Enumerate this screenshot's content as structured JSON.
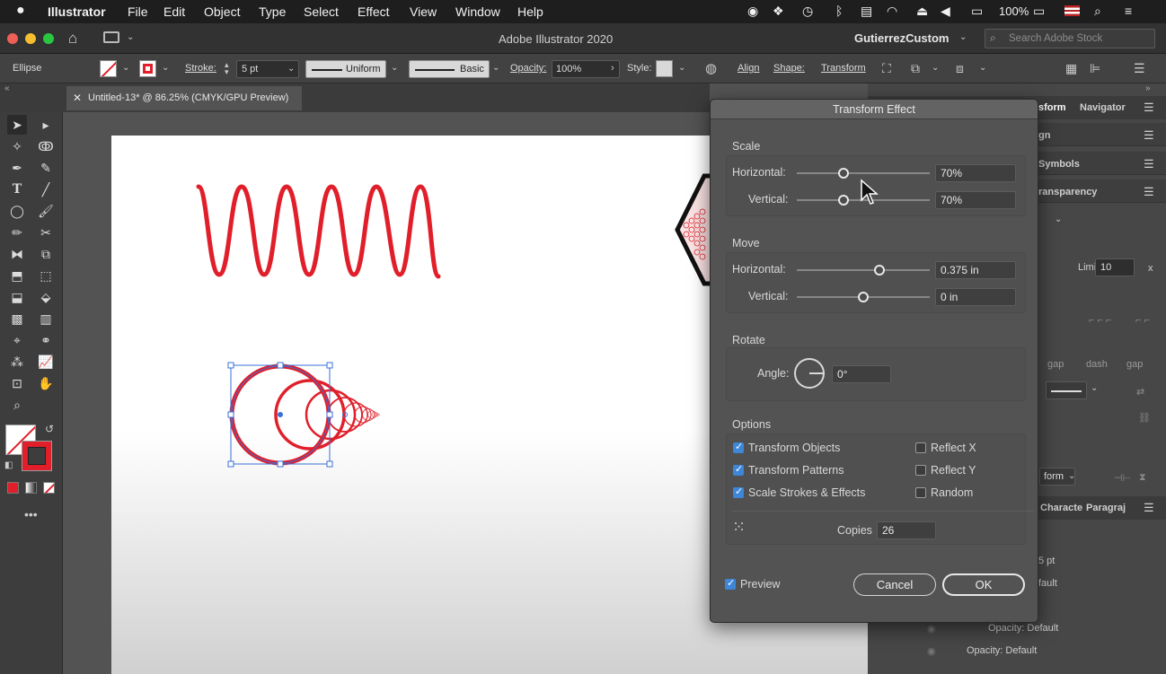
{
  "menubar": {
    "app_name": "Illustrator",
    "items": [
      "File",
      "Edit",
      "Object",
      "Type",
      "Select",
      "Effect",
      "View",
      "Window",
      "Help"
    ],
    "battery": "100%"
  },
  "appbar": {
    "title": "Adobe Illustrator 2020",
    "workspace": "GutierrezCustom",
    "search_placeholder": "Search Adobe Stock"
  },
  "control": {
    "object_type": "Ellipse",
    "stroke_label": "Stroke:",
    "stroke_weight": "5 pt",
    "profile_uniform": "Uniform",
    "brush_basic": "Basic",
    "opacity_label": "Opacity:",
    "opacity_value": "100%",
    "style_label": "Style:",
    "align_label": "Align",
    "shape_label": "Shape:",
    "transform_label": "Transform"
  },
  "document": {
    "tab_title": "Untitled-13* @ 86.25% (CMYK/GPU Preview)"
  },
  "panels": {
    "tab_transform": "sform",
    "tab_navigator": "Navigator",
    "row_align": "gn",
    "row_symbols": "Symbols",
    "row_transparency": "ransparency",
    "limit_label": "Limit:",
    "limit_value": "10",
    "dash_labels": [
      "gap",
      "dash",
      "gap"
    ],
    "transform_btn": "form",
    "tab_character": "Characte",
    "tab_paragraph": "Paragraj",
    "app_stroke": "5 pt",
    "app_fill": "fault",
    "opacity_row1": "Opacity: Default",
    "opacity_row2": "Opacity: Default"
  },
  "dialog": {
    "title": "Transform Effect",
    "scale": {
      "heading": "Scale",
      "h_label": "Horizontal:",
      "h_value": "70%",
      "v_label": "Vertical:",
      "v_value": "70%",
      "h_fraction": 0.35,
      "v_fraction": 0.35
    },
    "move": {
      "heading": "Move",
      "h_label": "Horizontal:",
      "h_value": "0.375 in",
      "v_label": "Vertical:",
      "v_value": "0 in",
      "h_fraction": 0.62,
      "v_fraction": 0.5
    },
    "rotate": {
      "heading": "Rotate",
      "angle_label": "Angle:",
      "angle_value": "0°"
    },
    "options": {
      "heading": "Options",
      "transform_objects": "Transform Objects",
      "transform_patterns": "Transform Patterns",
      "scale_strokes": "Scale Strokes & Effects",
      "reflect_x": "Reflect X",
      "reflect_y": "Reflect Y",
      "random": "Random",
      "copies_label": "Copies",
      "copies_value": "26",
      "checked": {
        "transform_objects": true,
        "transform_patterns": true,
        "scale_strokes": true,
        "reflect_x": false,
        "reflect_y": false,
        "random": false
      }
    },
    "preview_label": "Preview",
    "preview_checked": true,
    "cancel": "Cancel",
    "ok": "OK"
  },
  "colors": {
    "accent_red": "#e01f2a",
    "selection_blue": "#3a6fd8",
    "checkbox_blue": "#3e86d8"
  }
}
